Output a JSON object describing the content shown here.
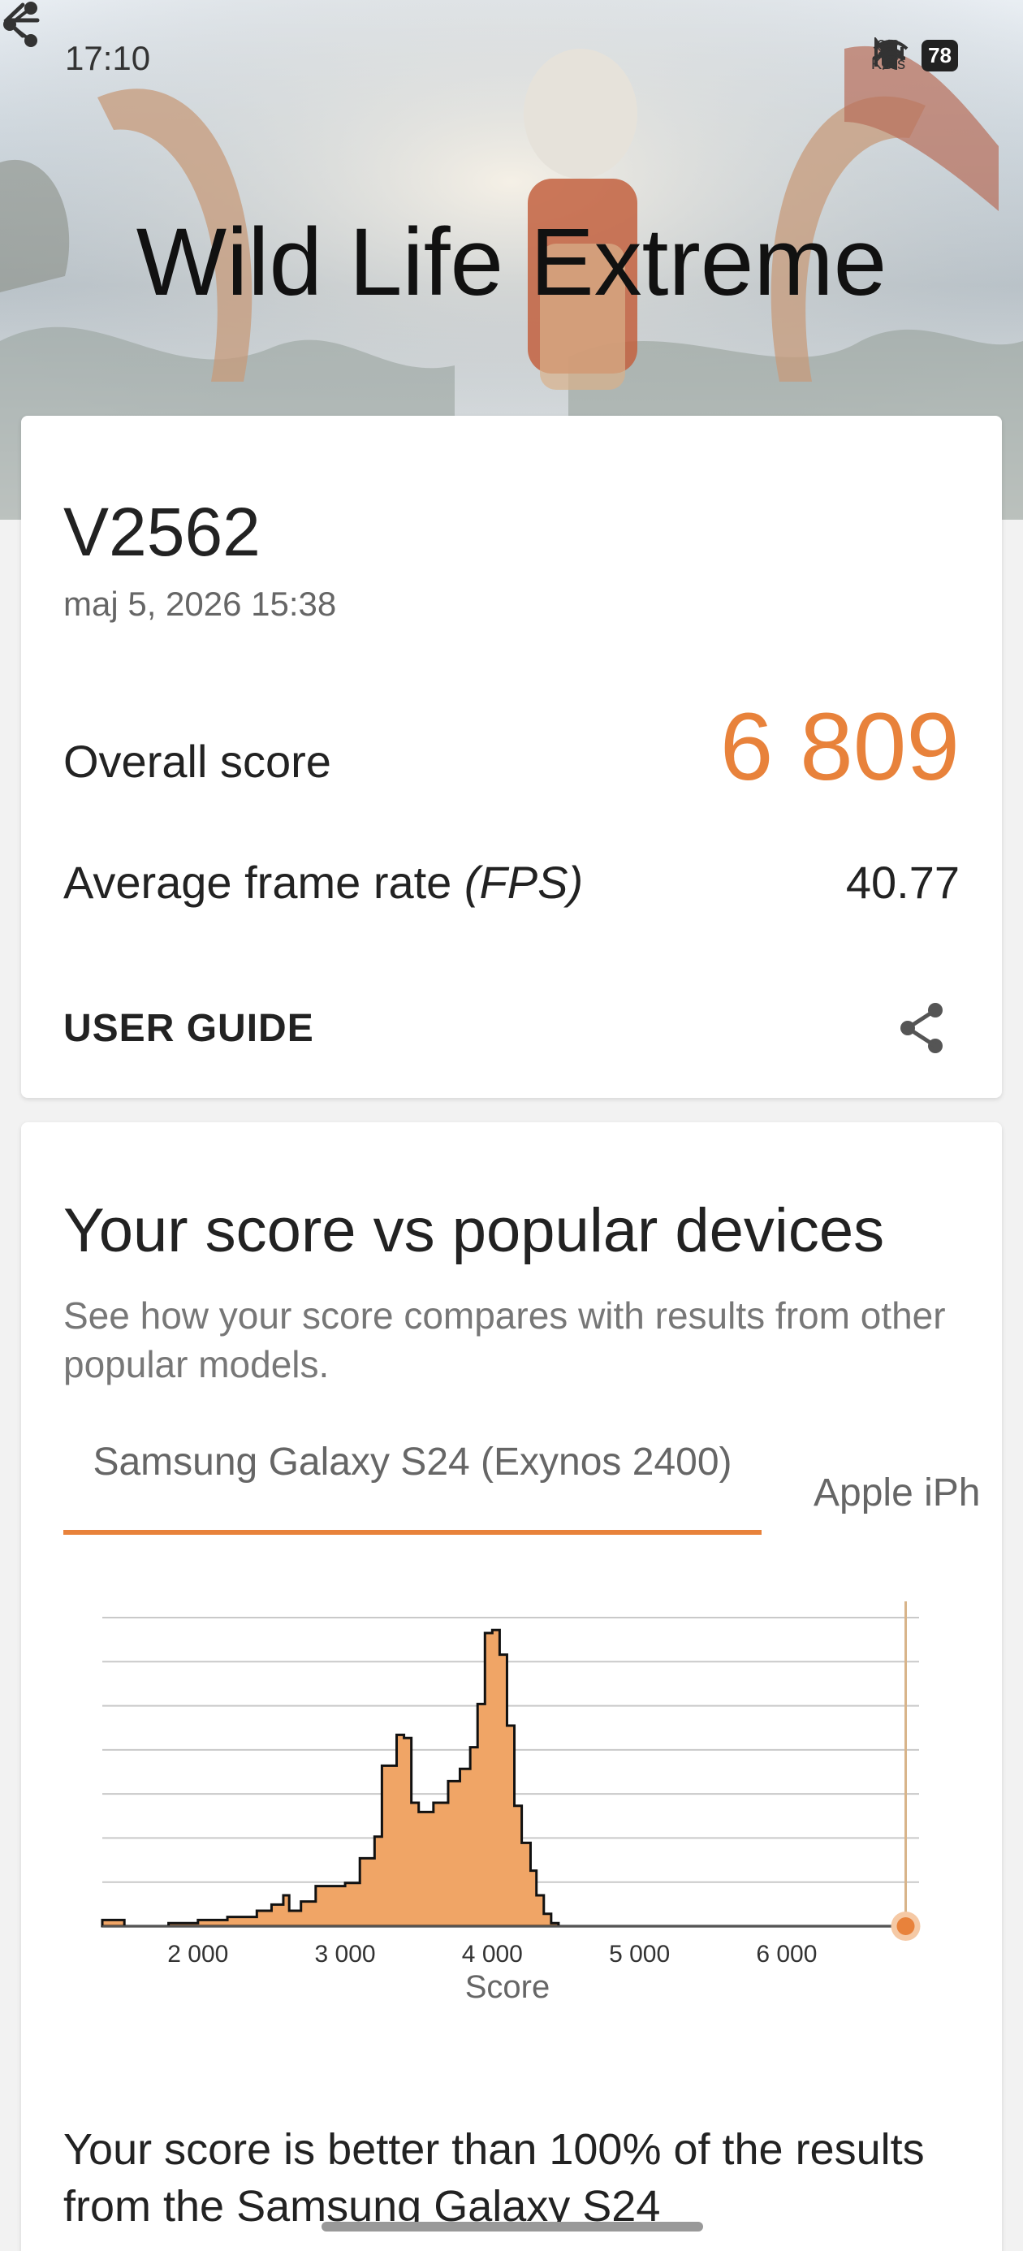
{
  "status_bar": {
    "time": "17:10",
    "network_speed_value": "0,2",
    "network_speed_unit": "KB/s",
    "battery": "78"
  },
  "header": {
    "title": "Wild Life Extreme"
  },
  "result": {
    "device": "V2562",
    "date": "maj 5, 2026 15:38",
    "overall_label": "Overall score",
    "overall_score": "6 809",
    "fps_label": "Average frame rate",
    "fps_label_unit": "(FPS)",
    "fps_value": "40.77",
    "user_guide": "USER GUIDE"
  },
  "comparison": {
    "title": "Your score vs popular devices",
    "subtitle": "See how your score compares with results from other popular models.",
    "tabs": [
      {
        "label": "Samsung Galaxy S24 (Exynos 2400)",
        "selected": true
      },
      {
        "label": "Apple iPh",
        "selected": false
      }
    ],
    "result_text": "Your score is better than 100% of the results from the Samsung Galaxy S24"
  },
  "colors": {
    "accent": "#e8823b",
    "histogram_fill": "#f0a566"
  },
  "chart_data": {
    "type": "area",
    "xlabel": "Score",
    "xlim": [
      1350,
      6900
    ],
    "x_ticks": [
      2000,
      3000,
      4000,
      5000,
      6000
    ],
    "x_tick_labels": [
      "2 000",
      "3 000",
      "4 000",
      "5 000",
      "6 000"
    ],
    "grid": true,
    "user_score": 6809,
    "series": [
      {
        "x": [
          1350,
          1500,
          1800,
          2000,
          2200,
          2400,
          2500,
          2580,
          2620,
          2700,
          2800,
          2900,
          3000,
          3100,
          3200,
          3250,
          3350,
          3400,
          3450,
          3500,
          3600,
          3700,
          3780,
          3850,
          3900,
          3950,
          4000,
          4050,
          4100,
          4150,
          4200,
          4260,
          4300,
          4350,
          4400,
          4450,
          4500,
          4600,
          6900
        ],
        "y": [
          0.02,
          0.0,
          0.01,
          0.02,
          0.03,
          0.05,
          0.07,
          0.1,
          0.05,
          0.08,
          0.13,
          0.13,
          0.14,
          0.22,
          0.29,
          0.52,
          0.62,
          0.61,
          0.4,
          0.37,
          0.4,
          0.47,
          0.51,
          0.58,
          0.72,
          0.95,
          0.96,
          0.88,
          0.65,
          0.39,
          0.27,
          0.18,
          0.1,
          0.04,
          0.01,
          0.0,
          0.0,
          0.0,
          0.0
        ]
      }
    ]
  }
}
